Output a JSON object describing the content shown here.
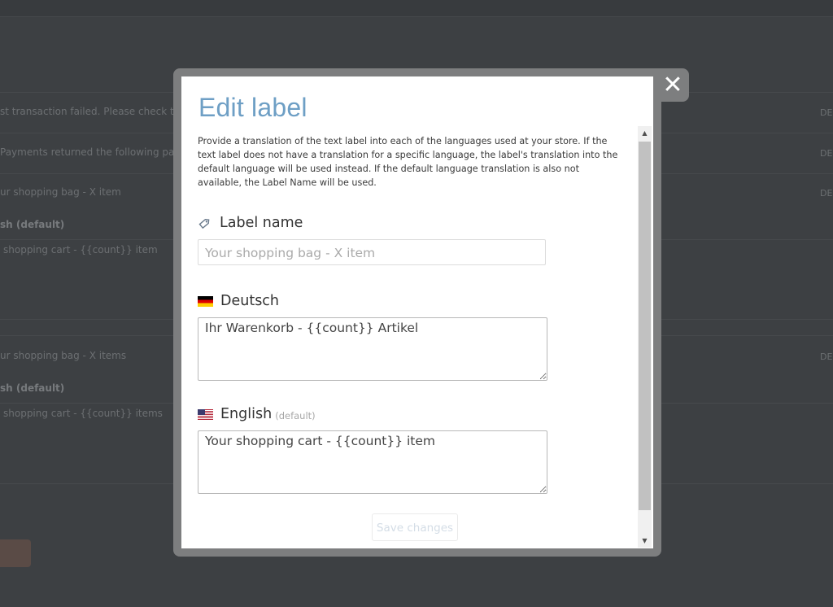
{
  "background": {
    "rows": [
      {
        "text": "st transaction failed. Please check the",
        "right": "DE"
      },
      {
        "text": "Payments returned the following paym",
        "right": "DE"
      },
      {
        "text": "ur shopping bag - X item",
        "right": "DE"
      },
      {
        "text": "sh (default)"
      },
      {
        "text": "shopping cart - {{count}} item"
      },
      {
        "text": "ur shopping bag - X items",
        "right": "DE"
      },
      {
        "text": "sh (default)"
      },
      {
        "text": "shopping cart - {{count}} items"
      }
    ]
  },
  "modal": {
    "close_label": "✕",
    "title": "Edit label",
    "description": "Provide a translation of the text label into each of the languages used at your store. If the text label does not have a translation for a specific language, the label's translation into the default language will be used instead. If the default language translation is also not available, the Label Name will be used.",
    "label_name": {
      "heading": "Label name",
      "placeholder": "Your shopping bag - X item"
    },
    "translations": [
      {
        "language": "Deutsch",
        "flag": "flag-de-icon",
        "value": "Ihr Warenkorb - {{count}} Artikel"
      },
      {
        "language": "English",
        "note": "(default)",
        "flag": "flag-us-icon",
        "value": "Your shopping cart - {{count}} item"
      }
    ],
    "save_label": "Save changes"
  },
  "colors": {
    "title": "#6e9fc5",
    "overlay": "#3d4043",
    "modal_frame": "#7d7e7f"
  }
}
